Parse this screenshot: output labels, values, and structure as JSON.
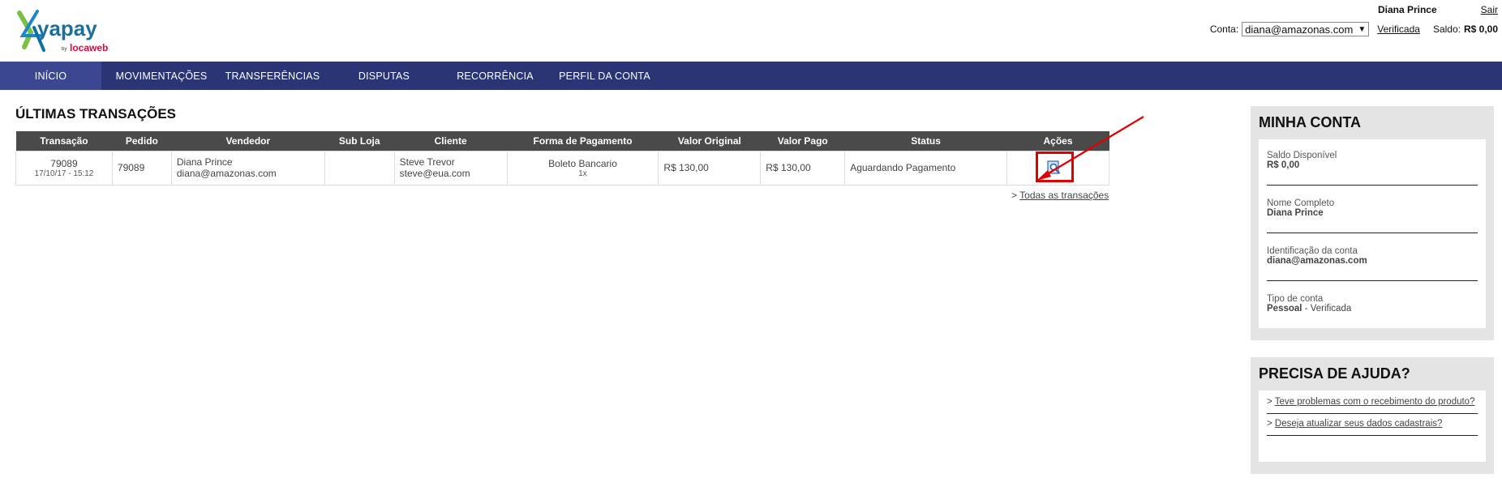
{
  "brand": {
    "name": "yapay",
    "tagline_by": "by",
    "tagline": "locaweb",
    "accent_green": "#7ac143",
    "accent_blue": "#1b87c9",
    "accent_red": "#e8003d"
  },
  "header": {
    "user_name": "Diana Prince",
    "logout_label": "Sair",
    "account_label": "Conta:",
    "account_value": "diana@amazonas.com",
    "verified_label": "Verificada",
    "balance_label": "Saldo:",
    "balance_value": "R$ 0,00"
  },
  "nav": {
    "items": [
      "INÍCIO",
      "MOVIMENTAÇÕES",
      "TRANSFERÊNCIAS",
      "DISPUTAS",
      "RECORRÊNCIA",
      "PERFIL DA CONTA"
    ],
    "active_index": 0,
    "bg_color": "#2b3475"
  },
  "main": {
    "title": "ÚLTIMAS TRANSAÇÕES",
    "columns": [
      "Transação",
      "Pedido",
      "Vendedor",
      "Sub Loja",
      "Cliente",
      "Forma de Pagamento",
      "Valor Original",
      "Valor Pago",
      "Status",
      "Ações"
    ],
    "rows": [
      {
        "transacao": "79089",
        "data": "17/10/17 - 15:12",
        "pedido": "79089",
        "vendedor_nome": "Diana Prince",
        "vendedor_email": "diana@amazonas.com",
        "sub_loja": "",
        "cliente_nome": "Steve Trevor",
        "cliente_email": "steve@eua.com",
        "forma_pagamento": "Boleto Bancario",
        "parcelas": "1x",
        "valor_original": "R$ 130,00",
        "valor_pago": "R$ 130,00",
        "status": "Aguardando Pagamento",
        "action_icon": "view-details-icon"
      }
    ],
    "all_prefix": ">",
    "all_link": "Todas as transações",
    "highlight_color": "#e00000"
  },
  "account_panel": {
    "title": "MINHA CONTA",
    "saldo_label": "Saldo Disponível",
    "saldo_value": "R$ 0,00",
    "nome_label": "Nome Completo",
    "nome_value": "Diana Prince",
    "id_label": "Identificação da conta",
    "id_value": "diana@amazonas.com",
    "tipo_label": "Tipo de conta",
    "tipo_value": "Pessoal",
    "tipo_sep": "-",
    "tipo_status": "Verificada"
  },
  "help_panel": {
    "title": "PRECISA DE AJUDA?",
    "links": [
      "Teve problemas com o recebimento do produto?",
      "Deseja atualizar seus dados cadastrais?"
    ],
    "prefix": ">"
  }
}
